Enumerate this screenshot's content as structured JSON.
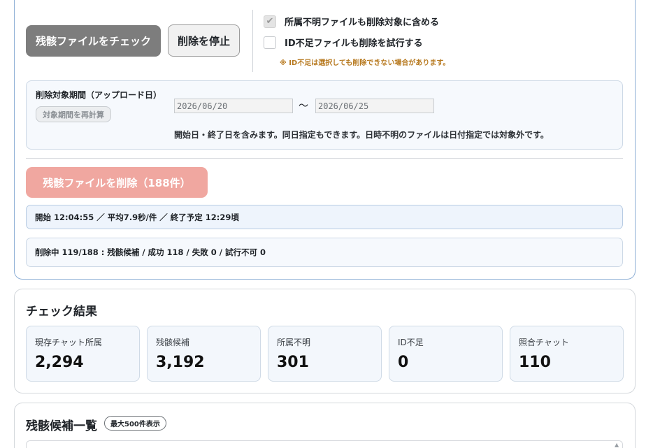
{
  "controls": {
    "check_button": "残骸ファイルをチェック",
    "stop_button": "削除を停止",
    "option_unknown_owner": {
      "label": "所属不明ファイルも削除対象に含める",
      "checked": true
    },
    "option_missing_id": {
      "label": "ID不足ファイルも削除を試行する",
      "checked": false
    },
    "note": "※ ID不足は選択しても削除できない場合があります。"
  },
  "period": {
    "title": "削除対象期間（アップロード日）",
    "recalc_button": "対象期間を再計算",
    "from": "2026/06/20",
    "separator": "〜",
    "to": "2026/06/25",
    "help": "開始日・終了日を含みます。同日指定もできます。日時不明のファイルは日付指定では対象外です。"
  },
  "delete": {
    "button": "残骸ファイルを削除（188件）"
  },
  "progress": {
    "timing": "開始 12:04:55 ／ 平均7.9秒/件 ／ 終了予定 12:29頃",
    "status": "削除中 119/188 : 残骸候補 / 成功 118 / 失敗 0 / 試行不可 0"
  },
  "results": {
    "title": "チェック結果",
    "stats": [
      {
        "label": "現存チャット所属",
        "value": "2,294"
      },
      {
        "label": "残骸候補",
        "value": "3,192"
      },
      {
        "label": "所属不明",
        "value": "301"
      },
      {
        "label": "ID不足",
        "value": "0"
      },
      {
        "label": "照合チャット",
        "value": "110"
      }
    ]
  },
  "candidates": {
    "title": "残骸候補一覧",
    "badge": "最大500件表示"
  },
  "icons": {
    "check": "checkmark-icon",
    "scroll": "scroll-up-icon"
  }
}
